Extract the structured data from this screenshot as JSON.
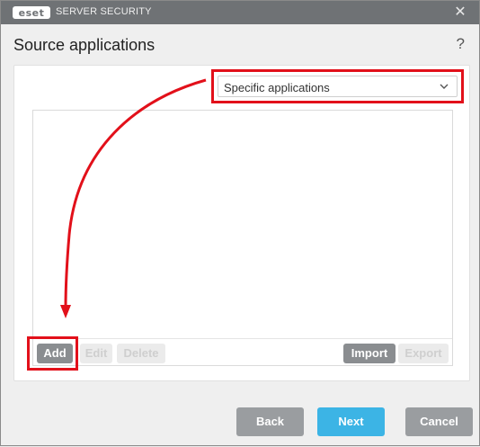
{
  "titlebar": {
    "logo_text": "eset",
    "product": "SERVER SECURITY",
    "close_glyph": "✕"
  },
  "dialog": {
    "title": "Source applications",
    "help_glyph": "?"
  },
  "dropdown": {
    "selected": "Specific applications",
    "icon": "chevron-down-icon"
  },
  "list_toolbar": {
    "add_label": "Add",
    "edit_label": "Edit",
    "delete_label": "Delete",
    "import_label": "Import",
    "export_label": "Export"
  },
  "footer": {
    "back_label": "Back",
    "next_label": "Next",
    "cancel_label": "Cancel"
  },
  "colors": {
    "titlebar": "#6f7275",
    "highlight": "#e2101a",
    "primary": "#3cb4e5",
    "secondary": "#9a9da0"
  }
}
